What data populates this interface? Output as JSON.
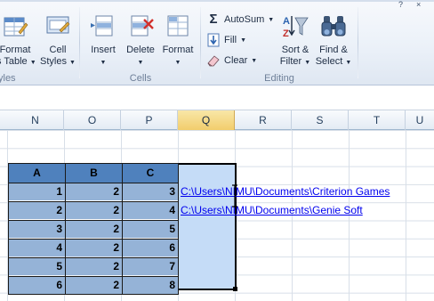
{
  "ribbon": {
    "styles_group": {
      "label": "yles",
      "format_table": {
        "line1": "Format",
        "line2": "s Table"
      },
      "cell_styles": {
        "line1": "Cell",
        "line2": "Styles"
      }
    },
    "cells_group": {
      "label": "Cells",
      "insert": "Insert",
      "delete": "Delete",
      "format": "Format"
    },
    "editing_group": {
      "label": "Editing",
      "autosum": "AutoSum",
      "fill": "Fill",
      "clear": "Clear",
      "sort_filter": {
        "line1": "Sort &",
        "line2": "Filter"
      },
      "find_select": {
        "line1": "Find &",
        "line2": "Select"
      }
    },
    "window_controls": {
      "help": "?",
      "close": "×"
    }
  },
  "sheet": {
    "columns": [
      "N",
      "O",
      "P",
      "Q",
      "R",
      "S",
      "T",
      "U"
    ],
    "selected_column": "Q",
    "table": {
      "headers": [
        "A",
        "B",
        "C"
      ],
      "rows": [
        [
          "1",
          "2",
          "3"
        ],
        [
          "2",
          "2",
          "4"
        ],
        [
          "3",
          "2",
          "5"
        ],
        [
          "4",
          "2",
          "6"
        ],
        [
          "5",
          "2",
          "7"
        ],
        [
          "6",
          "2",
          "8"
        ]
      ]
    },
    "hyperlinks": [
      "C:\\Users\\NIMU\\Documents\\Criterion Games",
      "C:\\Users\\NIMU\\Documents\\Genie Soft"
    ]
  },
  "colors": {
    "table_header": "#4f81bd",
    "table_body": "#95b3d7",
    "selection": "#c5dcf7",
    "selected_header": "#f2cd6c",
    "hyperlink": "#0000ee"
  }
}
